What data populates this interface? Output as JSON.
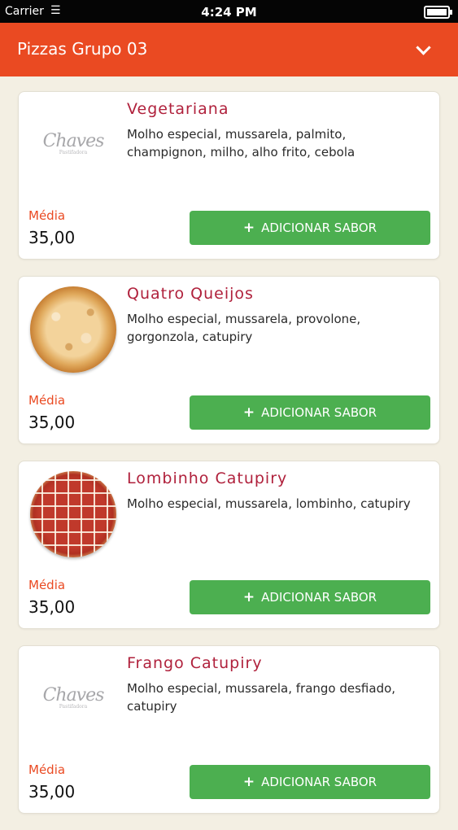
{
  "status_bar": {
    "carrier": "Carrier",
    "time": "4:24 PM"
  },
  "header": {
    "title": "Pizzas Grupo 03"
  },
  "items": [
    {
      "name": "Vegetariana",
      "description": "Molho especial, mussarela, palmito, champignon, milho, alho frito, cebola",
      "image": "chaves-logo",
      "size_label": "Média",
      "price": "35,00",
      "button_label": "ADICIONAR SABOR"
    },
    {
      "name": "Quatro Queijos",
      "description": "Molho especial, mussarela, provolone, gorgonzola, catupiry",
      "image": "pizza-cheese",
      "size_label": "Média",
      "price": "35,00",
      "button_label": "ADICIONAR SABOR"
    },
    {
      "name": "Lombinho Catupiry",
      "description": "Molho especial, mussarela, lombinho, catupiry",
      "image": "pizza-pepperoni",
      "size_label": "Média",
      "price": "35,00",
      "button_label": "ADICIONAR SABOR"
    },
    {
      "name": "Frango Catupiry",
      "description": "Molho especial, mussarela, frango desfiado, catupiry",
      "image": "chaves-logo",
      "size_label": "Média",
      "price": "35,00",
      "button_label": "ADICIONAR SABOR"
    }
  ],
  "logo": {
    "text": "Chaves",
    "subtext": "Pastifadora"
  },
  "colors": {
    "header": "#ea4a22",
    "button": "#4caf50",
    "title": "#b0213c",
    "size_label": "#ea4a22"
  }
}
